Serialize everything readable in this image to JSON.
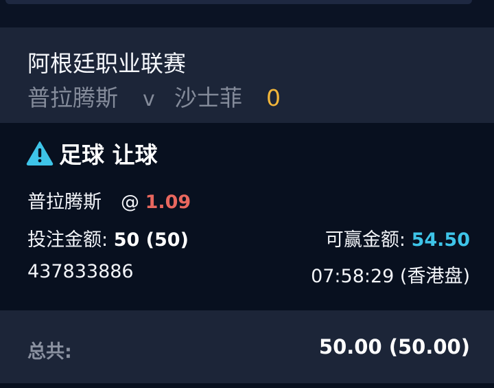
{
  "league": {
    "name": "阿根廷职业联赛"
  },
  "match": {
    "home_team": "普拉腾斯",
    "separator": "v",
    "away_team": "沙士菲",
    "score": "0"
  },
  "bet": {
    "icon": "warning-triangle-icon",
    "type": "足球 让球",
    "selection": "普拉腾斯",
    "at_symbol": "@",
    "odds": "1.09",
    "stake_label": "投注金额:",
    "stake_value": "50 (50)",
    "win_label": "可赢金额:",
    "win_value": "54.50",
    "ticket_id": "437833886",
    "time_info": "07:58:29 (香港盘)"
  },
  "total": {
    "label": "总共:",
    "value": "50.00 (50.00)"
  },
  "colors": {
    "background": "#08101f",
    "card": "#1c2538",
    "accent_cyan": "#3ec4e8",
    "odds_red": "#e8675e",
    "score_yellow": "#f2b63a"
  }
}
